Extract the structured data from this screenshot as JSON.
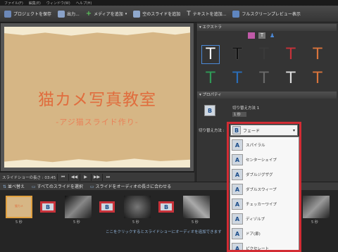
{
  "menu": [
    "ファイル(F)",
    "編集(E)",
    "ウィンドウ(W)",
    "ヘルプ(H)"
  ],
  "toolbar": {
    "save": "プロジェクトを保存",
    "output": "出力...",
    "add_media": "メディアを追加",
    "add_blank": "空のスライドを追加",
    "add_text": "テキストを追加...",
    "fullscreen": "フルスクリーンプレビュー表示"
  },
  "slide": {
    "title": "猫カメ写真教室",
    "subtitle": "-アジ猫スライド作り-"
  },
  "playback": {
    "length_label": "スライドショーの長さ : 03:45"
  },
  "stripbar": {
    "sort": "並べ替え",
    "select_all": "すべてのスライドを選択",
    "fit_audio": "スライドをオーディオの長さに合わせる"
  },
  "filmstrip": {
    "durations": [
      "5 秒",
      "5 秒",
      "5 秒",
      "5 秒",
      "5 秒"
    ],
    "hint": "ここをクリックするとスライドショーにオーディオを追加できます"
  },
  "panels": {
    "extras": "エクストラ",
    "properties": "プロパティ"
  },
  "text_styles": [
    {
      "glyph": "T",
      "color": "#ffffff",
      "icon": "text-style-outline"
    },
    {
      "glyph": "T",
      "color": "#111111",
      "icon": "text-style-black"
    },
    {
      "glyph": "T",
      "color": "#3a3a3a",
      "icon": "text-style-dark"
    },
    {
      "glyph": "T",
      "color": "#c8323a",
      "icon": "text-style-red"
    },
    {
      "glyph": "T",
      "color": "#d9743c",
      "icon": "text-style-orange"
    },
    {
      "glyph": "T",
      "color": "#2f9a57",
      "icon": "text-style-green"
    },
    {
      "glyph": "T",
      "color": "#2a6db8",
      "icon": "text-style-blue"
    },
    {
      "glyph": "T",
      "color": "#6a6a6a",
      "icon": "text-style-gray"
    },
    {
      "glyph": "T",
      "color": "#dddddd",
      "icon": "text-style-light"
    },
    {
      "glyph": "T",
      "color": "#d9743c",
      "icon": "text-style-orange2"
    }
  ],
  "properties": {
    "transition_name": "切り替え方法 1",
    "duration": "1 秒",
    "method_label": "切り替え方法 :"
  },
  "dropdown": {
    "selected": "フェード",
    "items": [
      "スパイラル",
      "センターシェイプ",
      "ダブルジグザグ",
      "ダブルスウィープ",
      "チェッカーワイプ",
      "ディゾルブ",
      "ドア(扉)",
      "ピクセレート"
    ]
  },
  "accent": "#d22c34"
}
